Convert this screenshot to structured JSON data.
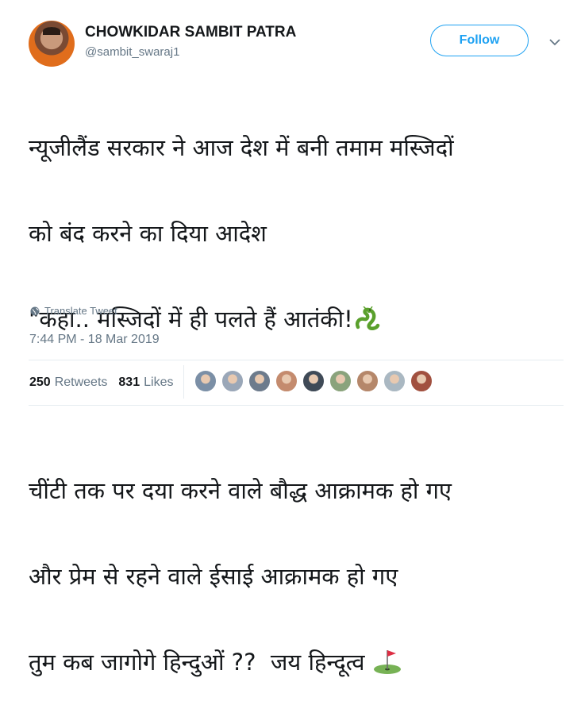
{
  "author": {
    "name": "CHOWKIDAR SAMBIT PATRA",
    "handle": "@sambit_swaraj1",
    "avatar_icon": "profile-photo"
  },
  "follow_label": "Follow",
  "tweet": {
    "lines": [
      "न्यूजीलैंड सरकार ने आज देश में बनी तमाम मस्जिदों",
      "को बंद करने का दिया आदेश",
      "\"कहा.. मस्जिदों में ही पलते हैं आतंकी!",
      "",
      "चींटी तक पर दया करने वाले बौद्ध आक्रामक हो गए",
      "और प्रेम से रहने वाले ईसाई आक्रामक हो गए",
      "तुम कब जागोगे हिन्दुओं ??  जय हिन्दूत्व "
    ],
    "emojis": [
      "dragon-emoji",
      "golf-flag-emoji"
    ]
  },
  "translate_label": "Translate Tweet",
  "timestamp": "7:44 PM - 18 Mar 2019",
  "stats": {
    "retweets_count": "250",
    "retweets_label": "Retweets",
    "likes_count": "831",
    "likes_label": "Likes"
  },
  "likers": [
    {
      "color": "#7b8fa6"
    },
    {
      "color": "#9aa7b8"
    },
    {
      "color": "#6d7b8c"
    },
    {
      "color": "#c48b6e"
    },
    {
      "color": "#3f4a57"
    },
    {
      "color": "#8aa37c"
    },
    {
      "color": "#b5876a"
    },
    {
      "color": "#aab8c2"
    },
    {
      "color": "#a1503f"
    }
  ],
  "colors": {
    "accent": "#1da1f2",
    "text": "#14171a",
    "secondary": "#657786",
    "divider": "#e6ecf0"
  }
}
